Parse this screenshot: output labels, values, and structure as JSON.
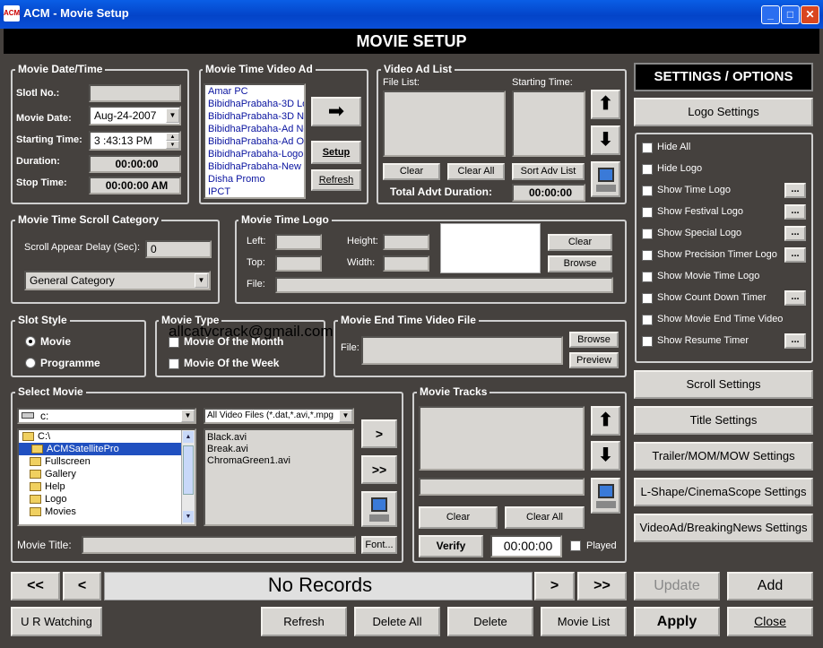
{
  "window": {
    "title": "ACM - Movie Setup",
    "icon_text": "ACM"
  },
  "header": {
    "title": "MOVIE SETUP"
  },
  "watermark": "allcatvcrack@gmail.com",
  "date_time": {
    "title": "Movie Date/Time",
    "slot_label": "Slotl No.:",
    "slot_value": "",
    "date_label": "Movie Date:",
    "date_value": "Aug-24-2007",
    "start_label": "Starting Time:",
    "start_value": "3 :43:13 PM",
    "duration_label": "Duration:",
    "duration_value": "00:00:00",
    "stop_label": "Stop Time:",
    "stop_value": "00:00:00 AM"
  },
  "video_ad": {
    "title": "Movie Time Video Ad",
    "items": [
      "Amar PC",
      "BibidhaPrabaha-3D Lo",
      "BibidhaPrabaha-3D Ne",
      "BibidhaPrabaha-Ad Ne",
      "BibidhaPrabaha-Ad Ol",
      "BibidhaPrabaha-Logo",
      "BibidhaPrabaha-New",
      "Disha Promo",
      "IPCT"
    ],
    "setup": "Setup",
    "refresh": "Refresh"
  },
  "ad_list": {
    "title": "Video Ad List",
    "file_list": "File List:",
    "starting_time": "Starting Time:",
    "clear": "Clear",
    "clear_all": "Clear All",
    "sort": "Sort Adv List",
    "total_label": "Total Advt Duration:",
    "total_value": "00:00:00"
  },
  "settings": {
    "title": "SETTINGS / OPTIONS",
    "logo_settings": "Logo Settings",
    "options": [
      {
        "label": "Hide All",
        "more": false
      },
      {
        "label": "Hide Logo",
        "more": false
      },
      {
        "label": "Show Time Logo",
        "more": true
      },
      {
        "label": "Show Festival Logo",
        "more": true
      },
      {
        "label": "Show Special Logo",
        "more": true
      },
      {
        "label": "Show Precision Timer Logo",
        "more": true
      },
      {
        "label": "Show Movie Time Logo",
        "more": false
      },
      {
        "label": "Show Count Down Timer",
        "more": true
      },
      {
        "label": "Show Movie End Time Video",
        "more": false
      },
      {
        "label": "Show Resume Timer",
        "more": true
      }
    ],
    "more_label": "...",
    "buttons": [
      "Scroll Settings",
      "Title Settings",
      "Trailer/MOM/MOW Settings",
      "L-Shape/CinemaScope Settings",
      "VideoAd/BreakingNews Settings"
    ]
  },
  "scroll": {
    "title": "Movie Time Scroll Category",
    "delay_label": "Scroll Appear Delay (Sec):",
    "delay_value": "0",
    "category": "General Category"
  },
  "logo": {
    "title": "Movie Time Logo",
    "left": "Left:",
    "top": "Top:",
    "height": "Height:",
    "width": "Width:",
    "file": "File:",
    "clear": "Clear",
    "browse": "Browse"
  },
  "slot_style": {
    "title": "Slot Style",
    "movie": "Movie",
    "programme": "Programme"
  },
  "movie_type": {
    "title": "Movie Type",
    "month": "Movie Of the Month",
    "week": "Movie Of the Week"
  },
  "end_video": {
    "title": "Movie End Time Video File",
    "file": "File:",
    "browse": "Browse",
    "preview": "Preview"
  },
  "select_movie": {
    "title": "Select Movie",
    "drive": "c:",
    "filter": "All Video Files (*.dat,*.avi,*.mpg",
    "folders": [
      "C:\\",
      "ACMSatellitePro",
      "Fullscreen",
      "Gallery",
      "Help",
      "Logo",
      "Movies"
    ],
    "files": [
      "Black.avi",
      "Break.avi",
      "ChromaGreen1.avi"
    ],
    "title_label": "Movie Title:",
    "font": "Font...",
    "add_one": ">",
    "add_all": ">>"
  },
  "tracks": {
    "title": "Movie Tracks",
    "clear": "Clear",
    "clear_all": "Clear All",
    "verify": "Verify",
    "time": "00:00:00",
    "played": "Played"
  },
  "nav": {
    "first": "<<",
    "prev": "<",
    "status": "No Records",
    "next": ">",
    "last": ">>"
  },
  "actions": {
    "update": "Update",
    "add": "Add",
    "apply": "Apply",
    "close": "Close",
    "ur_watching": "U R Watching",
    "refresh": "Refresh",
    "delete_all": "Delete All",
    "delete": "Delete",
    "movie_list": "Movie List"
  }
}
